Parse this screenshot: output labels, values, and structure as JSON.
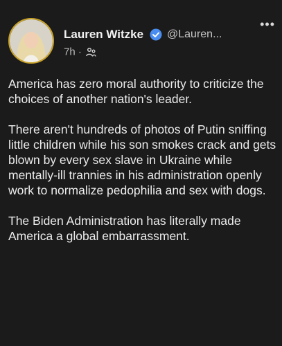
{
  "post": {
    "author_name": "Lauren Witzke",
    "handle": "@Lauren...",
    "time": "7h",
    "separator": "·",
    "paragraphs": [
      "America has zero moral authority to criticize the choices of another nation's leader.",
      "There aren't hundreds of photos of Putin sniffing little children while his son smokes crack and gets blown by every sex slave in Ukraine while mentally-ill trannies in his administration openly work to normalize pedophilia and sex with dogs.",
      "The Biden Administration has literally made America a global embarrassment."
    ]
  },
  "icons": {
    "verified": "verified-badge-icon",
    "audience": "audience-icon",
    "more": "more-icon"
  },
  "colors": {
    "background": "#1b1b1b",
    "verified_blue": "#4a8df0",
    "avatar_ring": "#c9a227"
  }
}
